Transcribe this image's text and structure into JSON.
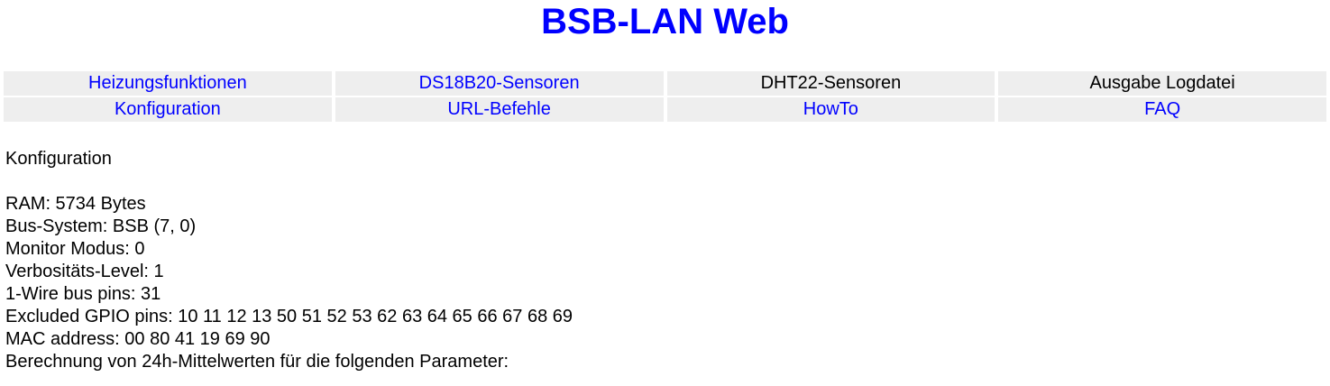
{
  "header": {
    "title": "BSB-LAN Web"
  },
  "nav": {
    "rows": [
      [
        {
          "label": "Heizungsfunktionen",
          "link": true
        },
        {
          "label": "DS18B20-Sensoren",
          "link": true
        },
        {
          "label": "DHT22-Sensoren",
          "link": false
        },
        {
          "label": "Ausgabe Logdatei",
          "link": false
        }
      ],
      [
        {
          "label": "Konfiguration",
          "link": true
        },
        {
          "label": "URL-Befehle",
          "link": true
        },
        {
          "label": "HowTo",
          "link": true
        },
        {
          "label": "FAQ",
          "link": true
        }
      ]
    ]
  },
  "content": {
    "section_title": "Konfiguration",
    "lines": [
      "RAM: 5734 Bytes",
      "Bus-System: BSB (7, 0)",
      "Monitor Modus: 0",
      "Verbositäts-Level: 1",
      "1-Wire bus pins: 31",
      "Excluded GPIO pins: 10 11 12 13 50 51 52 53 62 63 64 65 66 67 68 69",
      "MAC address: 00 80 41 19 69 90",
      "Berechnung von 24h-Mittelwerten für die folgenden Parameter:"
    ]
  },
  "colors": {
    "link": "#0000ff",
    "title": "#0000ff",
    "nav_bg": "#eeeeee",
    "text": "#000000"
  }
}
